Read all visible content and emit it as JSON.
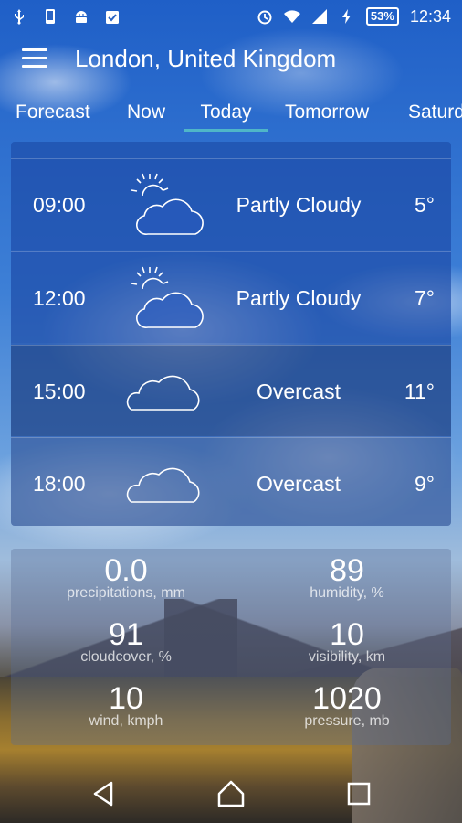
{
  "status_bar": {
    "battery": "53%",
    "time": "12:34",
    "icons": [
      "usb-icon",
      "phone-icon",
      "android-icon",
      "clipboard-check-icon",
      "alarm-icon",
      "wifi-icon",
      "signal-icon",
      "charging-icon"
    ]
  },
  "app_bar": {
    "title": "London, United Kingdom",
    "menu_icon": "hamburger-menu-icon"
  },
  "tabs": [
    {
      "label": "Forecast"
    },
    {
      "label": "Now"
    },
    {
      "label": "Today",
      "active": true
    },
    {
      "label": "Tomorrow"
    },
    {
      "label": "Saturday"
    }
  ],
  "hourly": [
    {
      "time": "09:00",
      "condition": "Partly Cloudy",
      "temp": "5°",
      "icon": "partly-cloudy-icon"
    },
    {
      "time": "12:00",
      "condition": "Partly Cloudy",
      "temp": "7°",
      "icon": "partly-cloudy-icon"
    },
    {
      "time": "15:00",
      "condition": "Overcast",
      "temp": "11°",
      "icon": "overcast-icon"
    },
    {
      "time": "18:00",
      "condition": "Overcast",
      "temp": "9°",
      "icon": "overcast-icon"
    }
  ],
  "details": {
    "precip": {
      "value": "0.0",
      "label": "precipitations, mm"
    },
    "humidity": {
      "value": "89",
      "label": "humidity, %"
    },
    "cloudcover": {
      "value": "91",
      "label": "cloudcover, %"
    },
    "visibility": {
      "value": "10",
      "label": "visibility, km"
    },
    "wind": {
      "value": "10",
      "label": "wind, kmph"
    },
    "pressure": {
      "value": "1020",
      "label": "pressure, mb"
    }
  },
  "colors": {
    "tab_indicator": "#4fb6c8",
    "sky": "#2a63c2"
  }
}
